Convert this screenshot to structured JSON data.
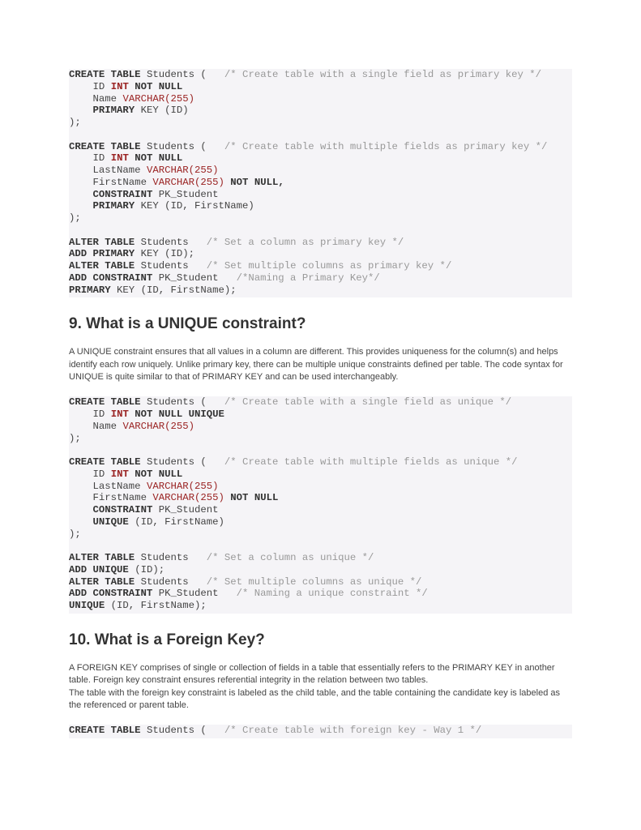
{
  "section9": {
    "heading": "9. What is a UNIQUE constraint?",
    "para": "A UNIQUE constraint ensures that all values in a column are different. This provides uniqueness for the column(s) and helps identify each row uniquely. Unlike primary key, there can be multiple unique constraints defined per table. The code syntax for UNIQUE is quite similar to that of PRIMARY KEY and can be used interchangeably."
  },
  "section10": {
    "heading": "10. What is a Foreign Key?",
    "para1": "A FOREIGN KEY comprises of single or collection of fields in a table that essentially refers to the PRIMARY KEY in another table. Foreign key constraint ensures referential integrity in the relation between two tables.",
    "para2": "The table with the foreign key constraint is labeled as the child table, and the table containing the candidate key is labeled as the referenced or parent table."
  },
  "code1": {
    "c1": "/* Create table with a single field as primary key */",
    "c2": "/* Create table with multiple fields as primary key */",
    "c3": "/* Set a column as primary key */",
    "c4": "/* Set multiple columns as primary key */",
    "c5": "/*Naming a Primary Key*/",
    "kw_create_table": "CREATE TABLE",
    "kw_int": "INT",
    "kw_not_null": "NOT NULL",
    "kw_varchar": "VARCHAR",
    "kw_primary": "PRIMARY",
    "kw_constraint": "CONSTRAINT",
    "kw_alter_table": "ALTER TABLE",
    "kw_add_primary": "ADD PRIMARY",
    "kw_add_constraint": "ADD CONSTRAINT",
    "kw_not_null_comma": "NOT NULL,",
    "v255": "(255)",
    "students": "Students",
    "lparen": "(",
    "id_field": "ID",
    "name_field": "Name",
    "lastname_field": "LastName",
    "firstname_field": "FirstName",
    "pk_student": "PK_Student",
    "key_id": "KEY (ID)",
    "key_id_semi": "KEY (ID);",
    "key_id_fn": "KEY (ID, FirstName)",
    "key_id_fn_semi": "KEY (ID, FirstName);",
    "close": ");"
  },
  "code2": {
    "c1": "/* Create table with a single field as unique */",
    "c2": "/* Create table with multiple fields as unique */",
    "c3": "/* Set a column as unique */",
    "c4": "/* Set multiple columns as unique */",
    "c5": "/* Naming a unique constraint */",
    "kw_unique": "UNIQUE",
    "kw_not_null_unique": "NOT NULL UNIQUE",
    "kw_add_unique": "ADD UNIQUE",
    "id_fn": "(ID, FirstName)",
    "id_semi": "(ID);",
    "id_fn_semi": "(ID, FirstName);"
  },
  "code3": {
    "c1": "/* Create table with foreign key - Way 1 */"
  }
}
